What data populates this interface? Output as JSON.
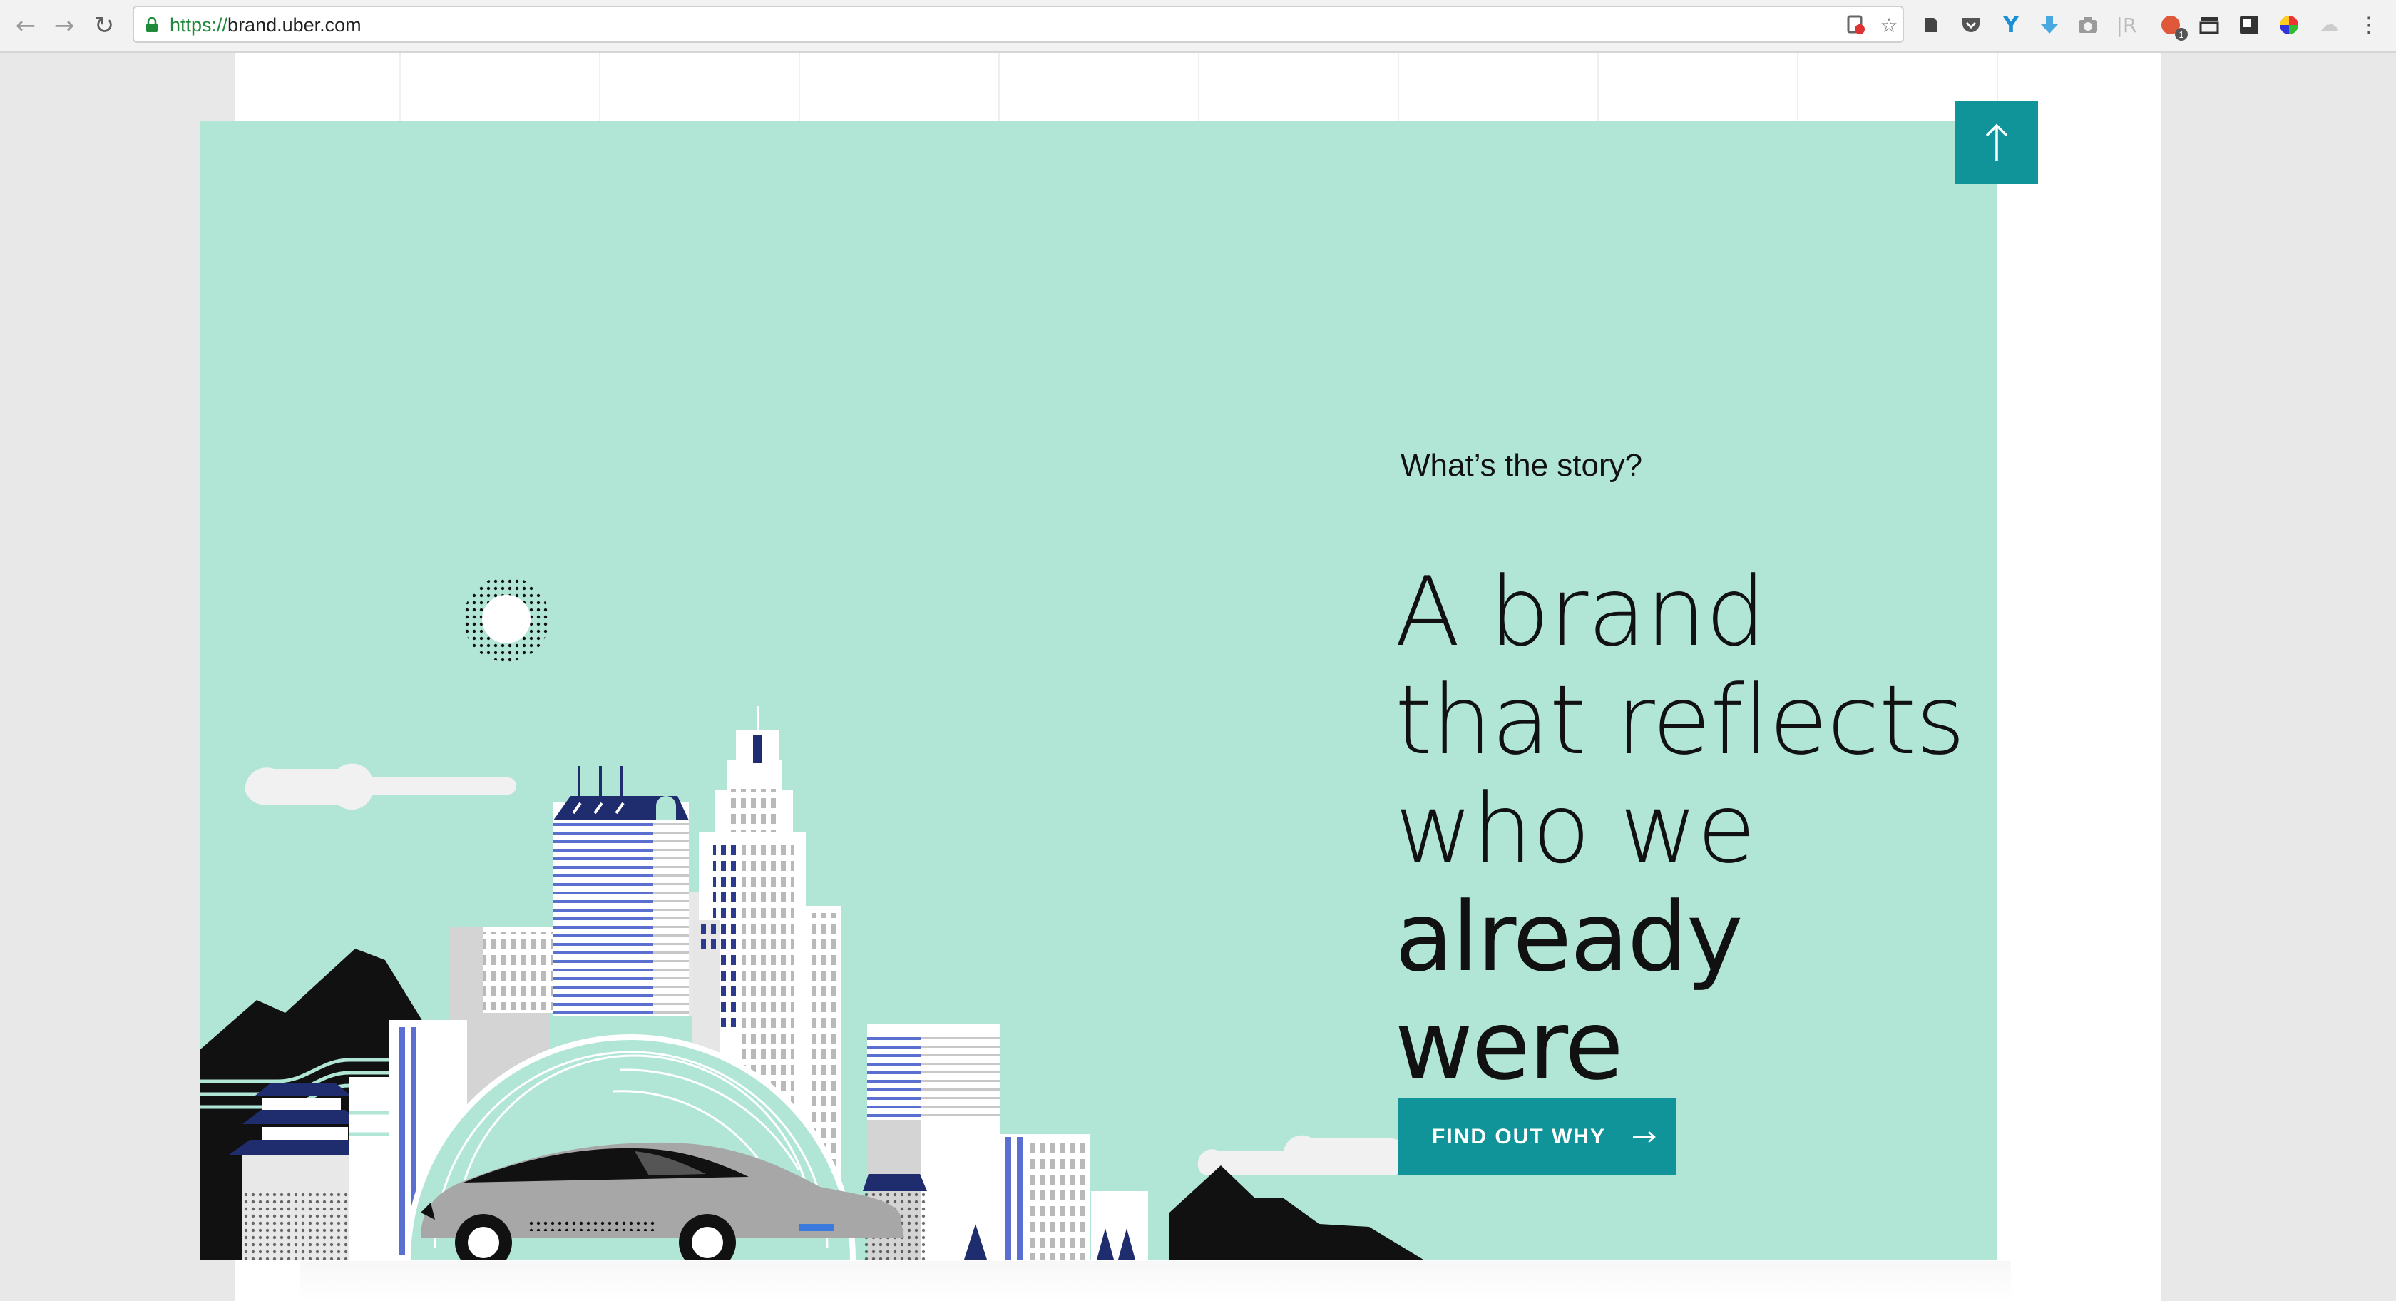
{
  "browser": {
    "url_scheme": "https://",
    "url_host": "brand.uber.com",
    "back_icon": "arrow-left-icon",
    "forward_icon": "arrow-right-icon",
    "reload_icon": "reload-icon",
    "extension_badge": "1"
  },
  "hero": {
    "eyebrow": "What’s the story?",
    "headline_lines": [
      "A brand",
      "that reflects",
      "who we"
    ],
    "headline_emphasis": "already were",
    "cta_label": "FIND OUT WHY",
    "background_color": "#b1e6d7",
    "accent_color": "#11939a"
  },
  "scroll_top": {
    "icon": "arrow-up-icon"
  }
}
